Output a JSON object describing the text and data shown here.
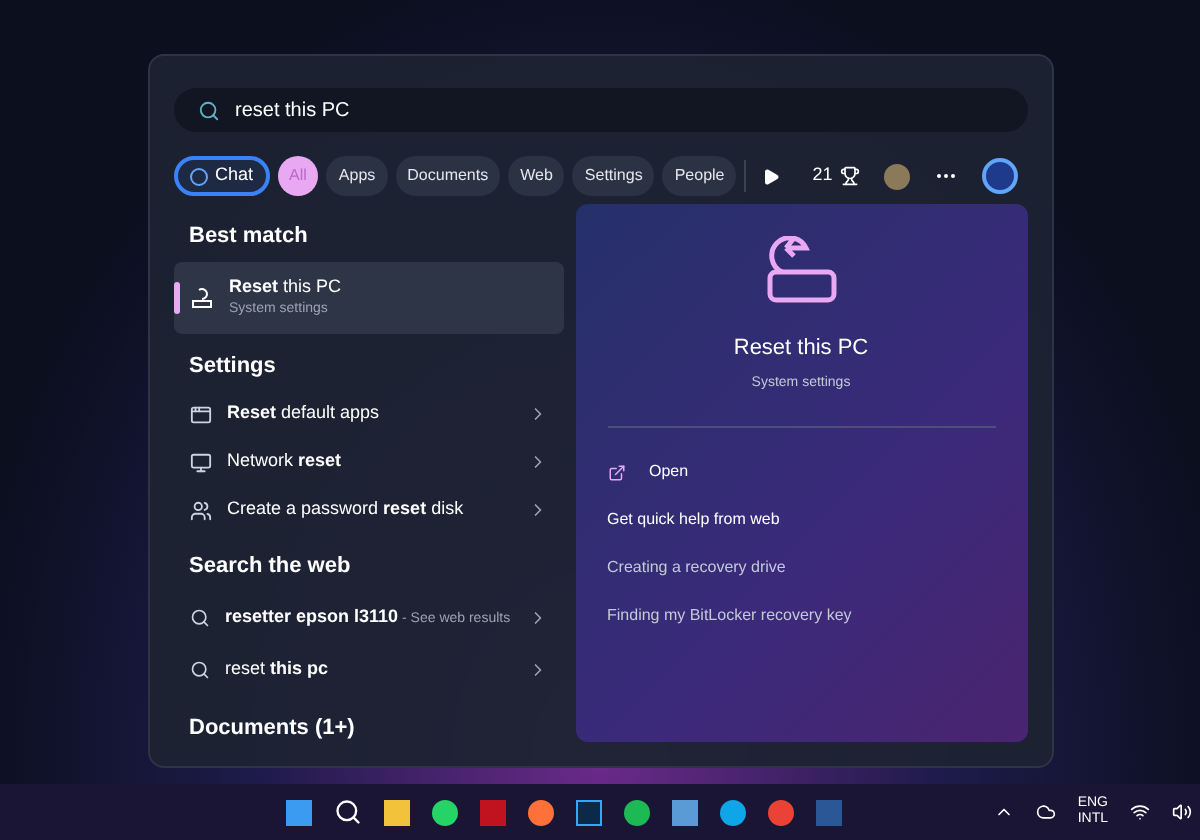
{
  "search": {
    "value": "reset this PC"
  },
  "chat_button": "Chat",
  "filters": [
    {
      "label": "All",
      "selected": true
    },
    {
      "label": "Apps",
      "selected": false
    },
    {
      "label": "Documents",
      "selected": false
    },
    {
      "label": "Web",
      "selected": false
    },
    {
      "label": "Settings",
      "selected": false
    },
    {
      "label": "People",
      "selected": false
    }
  ],
  "rewards_points": "21",
  "best_match": {
    "heading": "Best match",
    "title": "**Reset** this PC",
    "subtitle": "System settings",
    "selected": true
  },
  "settings": {
    "heading": "Settings",
    "items": [
      {
        "label": "**Reset** default apps"
      },
      {
        "label": "Network **reset**"
      },
      {
        "label": "Create a password **reset** disk"
      }
    ]
  },
  "web": {
    "heading": "Search the web",
    "items": [
      {
        "label": "**resetter epson l3110**",
        "suffix": "- See web results"
      },
      {
        "label": "reset **this pc**"
      }
    ]
  },
  "documents": {
    "heading": "Documents (1+)"
  },
  "preview": {
    "title": "Reset this PC",
    "subtitle": "System settings",
    "open": "Open",
    "help_heading": "Get quick help from web",
    "links": [
      "Creating a recovery drive",
      "Finding my BitLocker recovery key"
    ]
  },
  "taskbar": {
    "language": "ENG",
    "layout": "INTL"
  }
}
